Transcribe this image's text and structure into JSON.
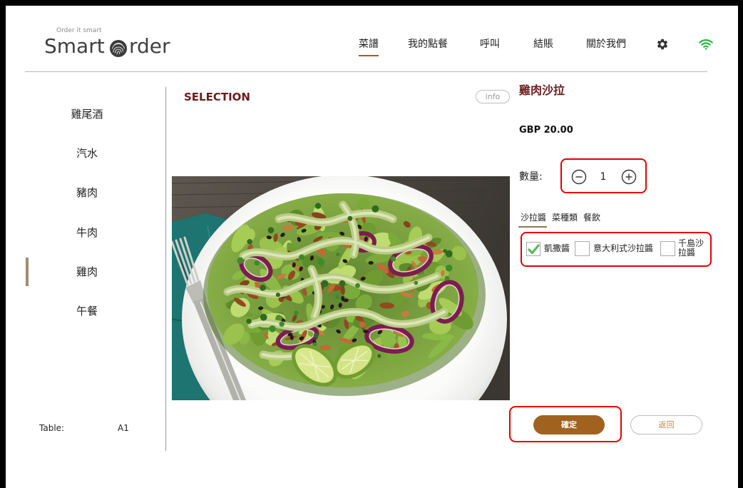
{
  "header": {
    "logo": {
      "tagline": "Order it smart",
      "word1": "Smart",
      "word2": "rder"
    },
    "nav": [
      {
        "label": "菜譜",
        "active": true
      },
      {
        "label": "我的點餐",
        "active": false
      },
      {
        "label": "呼叫",
        "active": false
      },
      {
        "label": "結賬",
        "active": false
      },
      {
        "label": "關於我們",
        "active": false
      }
    ],
    "icons": {
      "logo_o": "fingerprint-icon",
      "settings": "gear-icon",
      "connection": "wifi-icon"
    }
  },
  "sidebar": {
    "categories": [
      {
        "label": "雞尾酒",
        "active": false
      },
      {
        "label": "汽水",
        "active": false
      },
      {
        "label": "豬肉",
        "active": false
      },
      {
        "label": "牛肉",
        "active": false
      },
      {
        "label": "雞肉",
        "active": true
      },
      {
        "label": "午餐",
        "active": false
      }
    ],
    "table": {
      "label": "Table:",
      "value": "A1"
    }
  },
  "main": {
    "title": "SELECTION",
    "info_label": "info"
  },
  "detail": {
    "name": "雞肉沙拉",
    "price": "GBP 20.00",
    "quantity": {
      "label": "數量:",
      "value": "1",
      "decrease_icon": "minus-circle-icon",
      "increase_icon": "plus-circle-icon"
    },
    "tabs": [
      {
        "label": "沙拉醬",
        "active": true
      },
      {
        "label": "菜種類",
        "active": false
      },
      {
        "label": "餐飲",
        "active": false
      }
    ],
    "options": [
      {
        "label": "凱撒醬",
        "checked": true
      },
      {
        "label": "意大利式沙拉醬",
        "checked": false
      },
      {
        "label": "千島沙拉醬",
        "checked": false
      }
    ]
  },
  "actions": {
    "confirm": "確定",
    "back": "返回"
  },
  "colors": {
    "accent": "#a0621e",
    "title": "#6b1c1c",
    "connection": "#2db34a",
    "highlight": "#e50000",
    "active_marker": "#a08a74"
  }
}
